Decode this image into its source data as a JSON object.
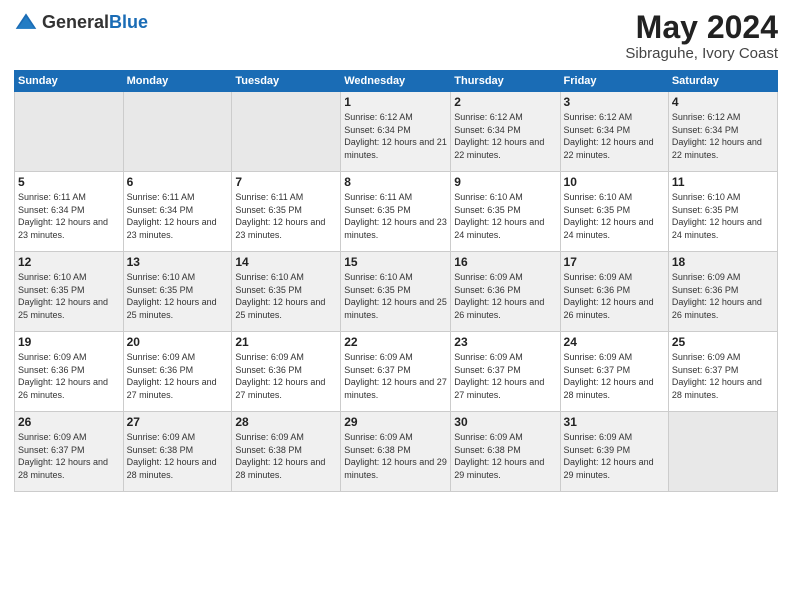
{
  "logo": {
    "general": "General",
    "blue": "Blue"
  },
  "header": {
    "title": "May 2024",
    "subtitle": "Sibraguhe, Ivory Coast"
  },
  "weekdays": [
    "Sunday",
    "Monday",
    "Tuesday",
    "Wednesday",
    "Thursday",
    "Friday",
    "Saturday"
  ],
  "weeks": [
    [
      {
        "day": "",
        "sunrise": "",
        "sunset": "",
        "daylight": ""
      },
      {
        "day": "",
        "sunrise": "",
        "sunset": "",
        "daylight": ""
      },
      {
        "day": "",
        "sunrise": "",
        "sunset": "",
        "daylight": ""
      },
      {
        "day": "1",
        "sunrise": "Sunrise: 6:12 AM",
        "sunset": "Sunset: 6:34 PM",
        "daylight": "Daylight: 12 hours and 21 minutes."
      },
      {
        "day": "2",
        "sunrise": "Sunrise: 6:12 AM",
        "sunset": "Sunset: 6:34 PM",
        "daylight": "Daylight: 12 hours and 22 minutes."
      },
      {
        "day": "3",
        "sunrise": "Sunrise: 6:12 AM",
        "sunset": "Sunset: 6:34 PM",
        "daylight": "Daylight: 12 hours and 22 minutes."
      },
      {
        "day": "4",
        "sunrise": "Sunrise: 6:12 AM",
        "sunset": "Sunset: 6:34 PM",
        "daylight": "Daylight: 12 hours and 22 minutes."
      }
    ],
    [
      {
        "day": "5",
        "sunrise": "Sunrise: 6:11 AM",
        "sunset": "Sunset: 6:34 PM",
        "daylight": "Daylight: 12 hours and 23 minutes."
      },
      {
        "day": "6",
        "sunrise": "Sunrise: 6:11 AM",
        "sunset": "Sunset: 6:34 PM",
        "daylight": "Daylight: 12 hours and 23 minutes."
      },
      {
        "day": "7",
        "sunrise": "Sunrise: 6:11 AM",
        "sunset": "Sunset: 6:35 PM",
        "daylight": "Daylight: 12 hours and 23 minutes."
      },
      {
        "day": "8",
        "sunrise": "Sunrise: 6:11 AM",
        "sunset": "Sunset: 6:35 PM",
        "daylight": "Daylight: 12 hours and 23 minutes."
      },
      {
        "day": "9",
        "sunrise": "Sunrise: 6:10 AM",
        "sunset": "Sunset: 6:35 PM",
        "daylight": "Daylight: 12 hours and 24 minutes."
      },
      {
        "day": "10",
        "sunrise": "Sunrise: 6:10 AM",
        "sunset": "Sunset: 6:35 PM",
        "daylight": "Daylight: 12 hours and 24 minutes."
      },
      {
        "day": "11",
        "sunrise": "Sunrise: 6:10 AM",
        "sunset": "Sunset: 6:35 PM",
        "daylight": "Daylight: 12 hours and 24 minutes."
      }
    ],
    [
      {
        "day": "12",
        "sunrise": "Sunrise: 6:10 AM",
        "sunset": "Sunset: 6:35 PM",
        "daylight": "Daylight: 12 hours and 25 minutes."
      },
      {
        "day": "13",
        "sunrise": "Sunrise: 6:10 AM",
        "sunset": "Sunset: 6:35 PM",
        "daylight": "Daylight: 12 hours and 25 minutes."
      },
      {
        "day": "14",
        "sunrise": "Sunrise: 6:10 AM",
        "sunset": "Sunset: 6:35 PM",
        "daylight": "Daylight: 12 hours and 25 minutes."
      },
      {
        "day": "15",
        "sunrise": "Sunrise: 6:10 AM",
        "sunset": "Sunset: 6:35 PM",
        "daylight": "Daylight: 12 hours and 25 minutes."
      },
      {
        "day": "16",
        "sunrise": "Sunrise: 6:09 AM",
        "sunset": "Sunset: 6:36 PM",
        "daylight": "Daylight: 12 hours and 26 minutes."
      },
      {
        "day": "17",
        "sunrise": "Sunrise: 6:09 AM",
        "sunset": "Sunset: 6:36 PM",
        "daylight": "Daylight: 12 hours and 26 minutes."
      },
      {
        "day": "18",
        "sunrise": "Sunrise: 6:09 AM",
        "sunset": "Sunset: 6:36 PM",
        "daylight": "Daylight: 12 hours and 26 minutes."
      }
    ],
    [
      {
        "day": "19",
        "sunrise": "Sunrise: 6:09 AM",
        "sunset": "Sunset: 6:36 PM",
        "daylight": "Daylight: 12 hours and 26 minutes."
      },
      {
        "day": "20",
        "sunrise": "Sunrise: 6:09 AM",
        "sunset": "Sunset: 6:36 PM",
        "daylight": "Daylight: 12 hours and 27 minutes."
      },
      {
        "day": "21",
        "sunrise": "Sunrise: 6:09 AM",
        "sunset": "Sunset: 6:36 PM",
        "daylight": "Daylight: 12 hours and 27 minutes."
      },
      {
        "day": "22",
        "sunrise": "Sunrise: 6:09 AM",
        "sunset": "Sunset: 6:37 PM",
        "daylight": "Daylight: 12 hours and 27 minutes."
      },
      {
        "day": "23",
        "sunrise": "Sunrise: 6:09 AM",
        "sunset": "Sunset: 6:37 PM",
        "daylight": "Daylight: 12 hours and 27 minutes."
      },
      {
        "day": "24",
        "sunrise": "Sunrise: 6:09 AM",
        "sunset": "Sunset: 6:37 PM",
        "daylight": "Daylight: 12 hours and 28 minutes."
      },
      {
        "day": "25",
        "sunrise": "Sunrise: 6:09 AM",
        "sunset": "Sunset: 6:37 PM",
        "daylight": "Daylight: 12 hours and 28 minutes."
      }
    ],
    [
      {
        "day": "26",
        "sunrise": "Sunrise: 6:09 AM",
        "sunset": "Sunset: 6:37 PM",
        "daylight": "Daylight: 12 hours and 28 minutes."
      },
      {
        "day": "27",
        "sunrise": "Sunrise: 6:09 AM",
        "sunset": "Sunset: 6:38 PM",
        "daylight": "Daylight: 12 hours and 28 minutes."
      },
      {
        "day": "28",
        "sunrise": "Sunrise: 6:09 AM",
        "sunset": "Sunset: 6:38 PM",
        "daylight": "Daylight: 12 hours and 28 minutes."
      },
      {
        "day": "29",
        "sunrise": "Sunrise: 6:09 AM",
        "sunset": "Sunset: 6:38 PM",
        "daylight": "Daylight: 12 hours and 29 minutes."
      },
      {
        "day": "30",
        "sunrise": "Sunrise: 6:09 AM",
        "sunset": "Sunset: 6:38 PM",
        "daylight": "Daylight: 12 hours and 29 minutes."
      },
      {
        "day": "31",
        "sunrise": "Sunrise: 6:09 AM",
        "sunset": "Sunset: 6:39 PM",
        "daylight": "Daylight: 12 hours and 29 minutes."
      },
      {
        "day": "",
        "sunrise": "",
        "sunset": "",
        "daylight": ""
      }
    ]
  ]
}
